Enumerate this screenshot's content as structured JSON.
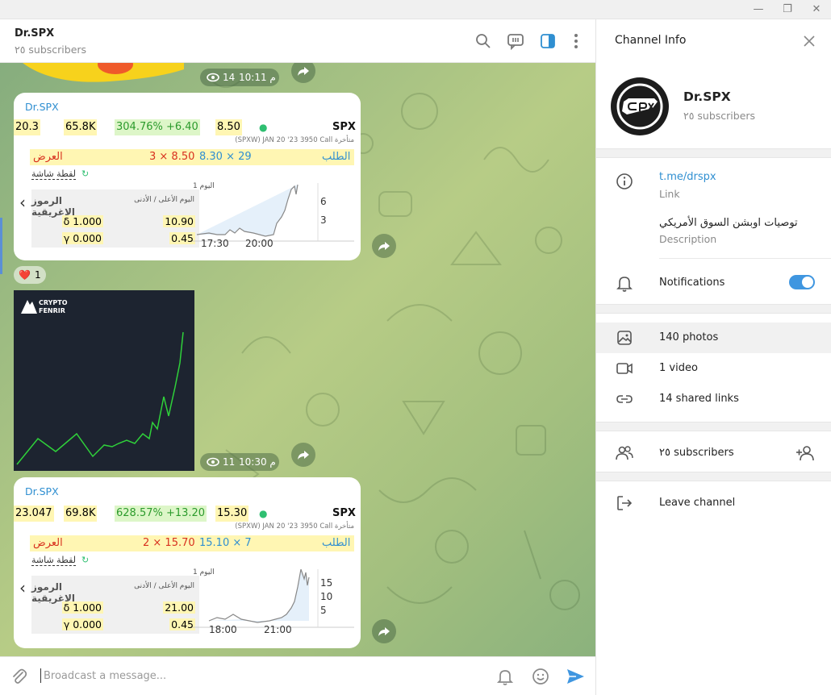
{
  "window": {
    "minimize": "—",
    "restore": "❐",
    "close": "✕"
  },
  "chat": {
    "title": "Dr.SPX",
    "subtitle": "٢٥ subscribers"
  },
  "messages": {
    "top_views": "14",
    "top_time": "م 10:11",
    "card1": {
      "author": "Dr.SPX",
      "q1": "20.3",
      "q2": "65.8K",
      "q3": "304.76% +6.40",
      "q4": "8.50",
      "dot": "●",
      "symbol": "SPX",
      "contract": "(SPXW) JAN 20 '23 3950 Call متأخرة",
      "ask_label": "العرض",
      "ask_val": "3 × 8.50",
      "bid_val": "8.30 × 29",
      "bid_label": "الطلب",
      "snap": "لقطة شاشة",
      "snap_icon": "↻",
      "chev": "‹",
      "greeks_label": "الرموز الإغريقية",
      "delta": "δ 1.000",
      "gamma": "γ 0.000",
      "hl_label": "اليوم الأعلى / الأدنى",
      "high": "10.90",
      "low": "0.45",
      "chart_period": "اليوم 1",
      "y_top": "6",
      "y_bot": "3",
      "x_left": "17:30",
      "x_right": "20:00"
    },
    "reaction": {
      "emoji": "❤️",
      "count": "1"
    },
    "photo": {
      "logo_line1": "CRYPTO",
      "logo_line2": "FENRIR",
      "views": "11",
      "time": "م 10:30"
    },
    "card2": {
      "author": "Dr.SPX",
      "q1": "23.047",
      "q2": "69.8K",
      "q3": "628.57% +13.20",
      "q4": "15.30",
      "dot": "●",
      "symbol": "SPX",
      "contract": "(SPXW) JAN 20 '23 3950 Call متأخرة",
      "ask_label": "العرض",
      "ask_val": "2 × 15.70",
      "bid_val": "15.10 × 7",
      "bid_label": "الطلب",
      "snap": "لقطة شاشة",
      "snap_icon": "↻",
      "chev": "‹",
      "greeks_label": "الرموز الإغريقية",
      "delta": "δ 1.000",
      "gamma": "γ 0.000",
      "hl_label": "اليوم الأعلى / الأدنى",
      "high": "21.00",
      "low": "0.45",
      "chart_period": "اليوم 1",
      "y_top": "15",
      "y_mid": "10",
      "y_bot": "5",
      "x_left": "18:00",
      "x_right": "21:00"
    }
  },
  "input": {
    "placeholder": "Broadcast a message..."
  },
  "panel": {
    "title": "Channel Info",
    "name": "Dr.SPX",
    "subscribers": "٢٥ subscribers",
    "link": "t.me/drspx",
    "link_caption": "Link",
    "description": "توصيات اوبشن السوق الأمريكي",
    "description_caption": "Description",
    "notifications": "Notifications",
    "notifications_on": true,
    "photos": "140 photos",
    "videos": "1 video",
    "links": "14 shared links",
    "members": "٢٥ subscribers",
    "leave": "Leave channel"
  },
  "colors": {
    "accent": "#2f8fd1",
    "toggle": "#3f96e0",
    "chat_bg": "#a4c07f",
    "chart_line": "#2fd13a"
  }
}
